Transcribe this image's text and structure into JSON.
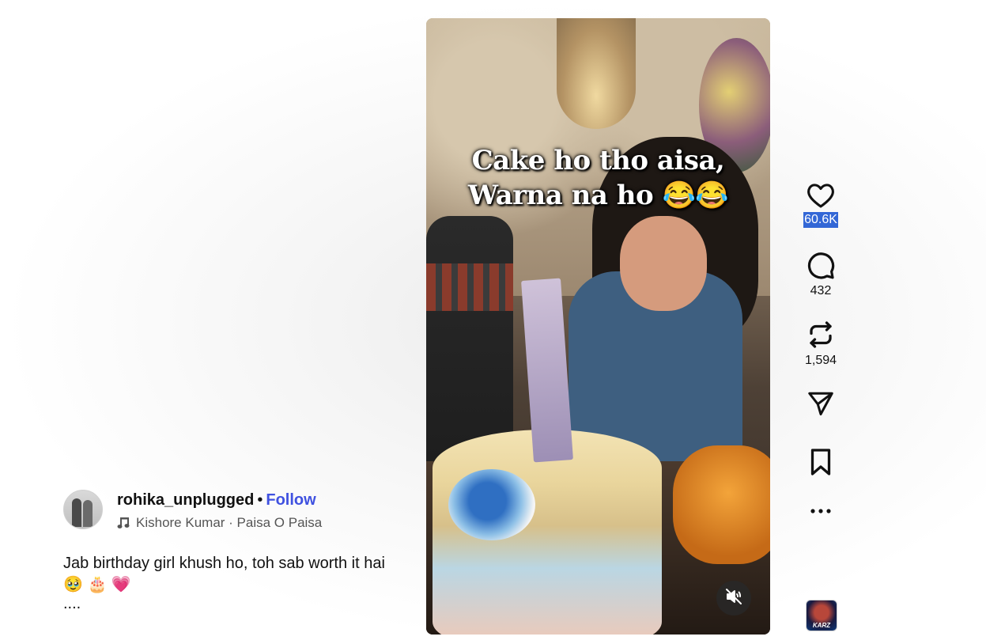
{
  "video": {
    "caption_line1": "Cake ho tho aisa,",
    "caption_line2": "Warna na ho 😂😂",
    "mute_icon": "speaker-muted-icon"
  },
  "actions": {
    "likes": "60.6K",
    "comments": "432",
    "reposts": "1,594"
  },
  "author": {
    "username": "rohika_unplugged",
    "separator": "•",
    "follow_label": "Follow",
    "audio": "Kishore Kumar · Paisa O Paisa"
  },
  "description": {
    "text": "Jab birthday girl khush ho, toh sab worth it hai 🥹 🎂 💗",
    "more": "...."
  },
  "music_thumb": {
    "label": "KARZ"
  },
  "colors": {
    "follow": "#3f51e0",
    "selection": "#3367d6"
  }
}
